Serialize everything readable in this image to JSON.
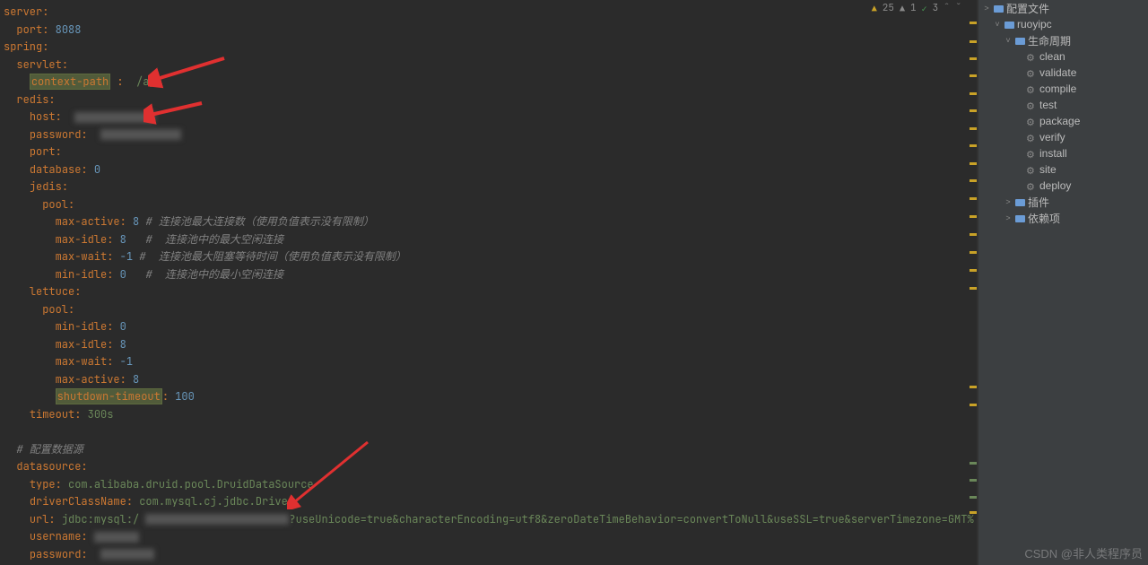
{
  "status": {
    "warn1_count": "25",
    "warn2_count": "1",
    "ok_count": "3"
  },
  "code": {
    "lines": [
      {
        "i": 0,
        "t": "server",
        "c": "punc",
        ":": ":"
      },
      {
        "i": 1,
        "k": "port",
        "v": "8088",
        "vt": "num"
      },
      {
        "i": 0,
        "t": "spring",
        "c": "punc",
        ":": ":"
      },
      {
        "i": 1,
        "k": "servlet",
        ":": ":"
      },
      {
        "i": 2,
        "k": "context-path",
        "hl": true,
        "sep": " :",
        "v": " /app",
        "vt": "val"
      },
      {
        "i": 1,
        "k": "redis",
        ":": ":"
      },
      {
        "i": 2,
        "k": "host",
        "v": "",
        "blur": true,
        "bw": 90
      },
      {
        "i": 2,
        "k": "password",
        "v": "",
        "blur": true,
        "bw": 90
      },
      {
        "i": 2,
        "k": "port",
        ":": ":"
      },
      {
        "i": 2,
        "k": "database",
        "v": "0",
        "vt": "num"
      },
      {
        "i": 2,
        "k": "jedis",
        ":": ":"
      },
      {
        "i": 3,
        "k": "pool",
        ":": ":"
      },
      {
        "i": 4,
        "k": "max-active",
        "v": "8",
        "vt": "num",
        "cm": "# 连接池最大连接数（使用负值表示没有限制）"
      },
      {
        "i": 4,
        "k": "max-idle",
        "v": "8",
        "vt": "num",
        "cm": "#  连接池中的最大空闲连接",
        "pad": "   "
      },
      {
        "i": 4,
        "k": "max-wait",
        "v": "-1",
        "vt": "num",
        "cm": "#  连接池最大阻塞等待时间（使用负值表示没有限制）",
        "pad": " "
      },
      {
        "i": 4,
        "k": "min-idle",
        "v": "0",
        "vt": "num",
        "cm": "#  连接池中的最小空闲连接",
        "pad": "   "
      },
      {
        "i": 2,
        "k": "lettuce",
        ":": ":"
      },
      {
        "i": 3,
        "k": "pool",
        ":": ":"
      },
      {
        "i": 4,
        "k": "min-idle",
        "v": "0",
        "vt": "num"
      },
      {
        "i": 4,
        "k": "max-idle",
        "v": "8",
        "vt": "num"
      },
      {
        "i": 4,
        "k": "max-wait",
        "v": "-1",
        "vt": "num"
      },
      {
        "i": 4,
        "k": "max-active",
        "v": "8",
        "vt": "num"
      },
      {
        "i": 4,
        "k": "shutdown-timeout",
        "hl": true,
        "v": "100",
        "vt": "num"
      },
      {
        "i": 2,
        "k": "timeout",
        "v": "300s",
        "vt": "val"
      },
      {
        "blank": true
      },
      {
        "i": 1,
        "raw": "# 配置数据源",
        "rt": "comment"
      },
      {
        "i": 1,
        "k": "datasource",
        ":": ":"
      },
      {
        "i": 2,
        "k": "type",
        "v": "com.alibaba.druid.pool.DruidDataSource",
        "vt": "val"
      },
      {
        "i": 2,
        "k": "driverClassName",
        "v": "com.mysql.cj.jdbc.Driver",
        "vt": "val"
      },
      {
        "i": 2,
        "k": "url",
        "v": "jdbc:mysql:/",
        "vt": "val",
        "blur": true,
        "bw": 160,
        "tail": "?useUnicode=true&characterEncoding=utf8&zeroDateTimeBehavior=convertToNull&useSSL=true&serverTimezone=GMT%"
      },
      {
        "i": 2,
        "k": "username",
        "blur": true,
        "bw": 50
      },
      {
        "i": 2,
        "k": "password",
        "v": "",
        "blur": true,
        "bw": 60
      }
    ]
  },
  "warnmarks": [
    24,
    45,
    64,
    83,
    103,
    122,
    142,
    161,
    181,
    200,
    220,
    240,
    260,
    280,
    300,
    320,
    430,
    450,
    570
  ],
  "okmarks": [
    515,
    534,
    553
  ],
  "tree": {
    "root": {
      "label": "配置文件",
      "icon": "folder",
      "expanded": true
    },
    "proj": {
      "label": "ruoyipc",
      "icon": "folder",
      "expanded": true
    },
    "lifecycle": {
      "label": "生命周期",
      "icon": "folder",
      "expanded": true
    },
    "tasks": [
      "clean",
      "validate",
      "compile",
      "test",
      "package",
      "verify",
      "install",
      "site",
      "deploy"
    ],
    "plugins": {
      "label": "插件"
    },
    "deps": {
      "label": "依赖项"
    }
  },
  "watermark": "CSDN @非人类程序员"
}
